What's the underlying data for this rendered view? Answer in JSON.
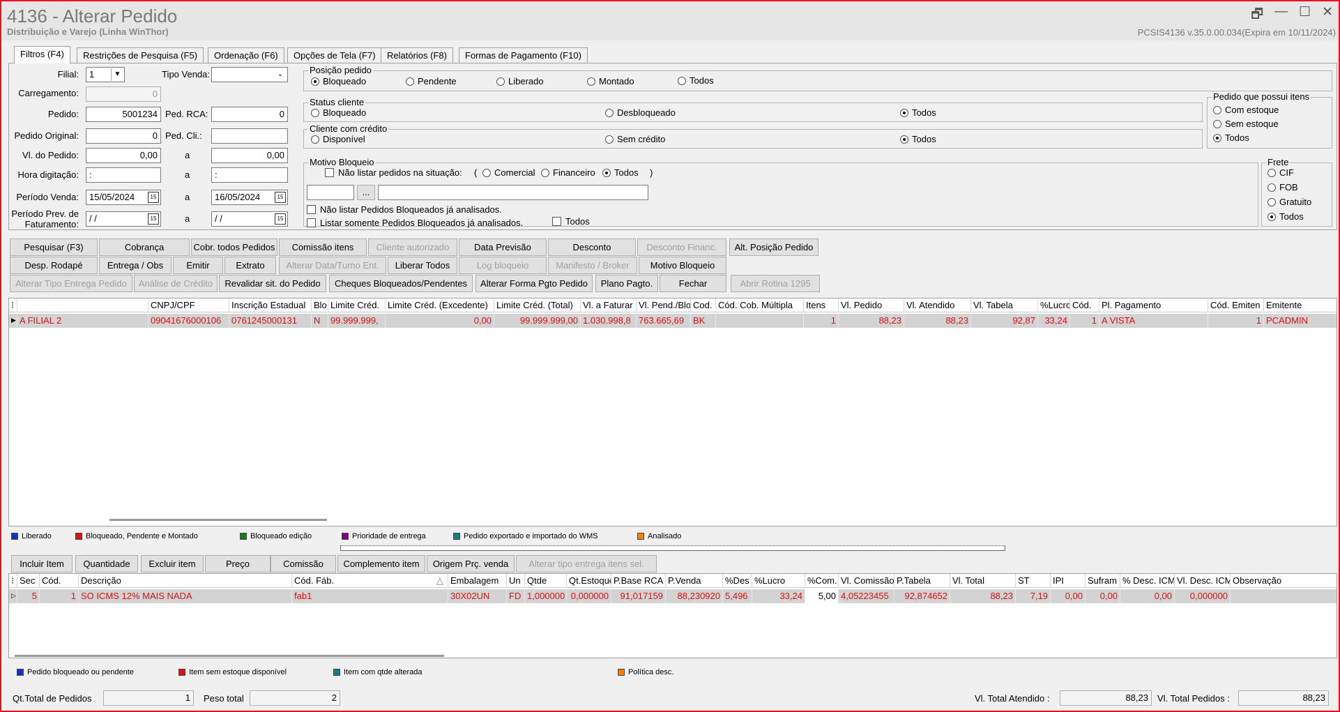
{
  "window": {
    "title": "4136 - Alterar Pedido",
    "subtitle": "Distribuição e Varejo (Linha WinThor)",
    "version": "PCSIS4136  v.35.0.00.034(Expira em 10/11/2024)",
    "controls": [
      "🗗",
      "—",
      "☐",
      "✕"
    ]
  },
  "tabs": [
    "Filtros (F4)",
    "Restrições de Pesquisa (F5)",
    "Ordenação (F6)",
    "Opções de Tela (F7)",
    "Relatórios (F8)",
    "Formas de Pagamento (F10)"
  ],
  "filters": {
    "filial_label": "Filial:",
    "filial_value": "1",
    "tipo_venda_label": "Tipo Venda:",
    "tipo_venda_value": "",
    "carregamento_label": "Carregamento:",
    "carregamento_value": "0",
    "pedido_label": "Pedido:",
    "pedido_value": "5001234",
    "ped_rca_label": "Ped. RCA:",
    "ped_rca_value": "0",
    "pedido_original_label": "Pedido Original:",
    "pedido_original_value": "0",
    "ped_cli_label": "Ped. Cli.:",
    "ped_cli_value": "",
    "vl_pedido_label": "Vl. do Pedido:",
    "vl_pedido_from": "0,00",
    "vl_pedido_to": "0,00",
    "a": "a",
    "hora_label": "Hora digitação:",
    "hora_from": ":",
    "hora_to": ":",
    "periodo_venda_label": "Período Venda:",
    "periodo_venda_from": "15/05/2024",
    "periodo_venda_to": "16/05/2024",
    "periodo_prev_label1": "Período Prev. de",
    "periodo_prev_label2": "Faturamento:",
    "periodo_prev_from": "/ /",
    "periodo_prev_to": "/ /",
    "cal_icon": "15"
  },
  "posicao": {
    "title": "Posição pedido",
    "options": [
      "Bloqueado",
      "Pendente",
      "Liberado",
      "Montado",
      "Todos"
    ]
  },
  "status_cliente": {
    "title": "Status cliente",
    "options": [
      "Bloqueado",
      "Desbloqueado",
      "Todos"
    ]
  },
  "cliente_credito": {
    "title": "Cliente com crédito",
    "options": [
      "Disponível",
      "Sem crédito",
      "Todos"
    ]
  },
  "pedido_itens": {
    "title": "Pedido que possui itens",
    "options": [
      "Com estoque",
      "Sem estoque",
      "Todos"
    ]
  },
  "motivo": {
    "title": "Motivo Bloqueio",
    "nao_listar": "Não listar pedidos na situação:",
    "paren_open": "(",
    "paren_close": ")",
    "opts": [
      "Comercial",
      "Financeiro",
      "Todos"
    ],
    "ellipsis": "...",
    "chk1": "Não listar Pedidos Bloqueados já analisados.",
    "chk2": "Listar somente Pedidos Bloqueados já analisados.",
    "chk_todos": "Todos"
  },
  "frete": {
    "title": "Frete",
    "options": [
      "CIF",
      "FOB",
      "Gratuito",
      "Todos"
    ]
  },
  "buttons": {
    "row1": [
      "Pesquisar (F3)",
      "Cobrança",
      "Cobr. todos Pedidos",
      "Comissão itens",
      "Cliente autorizado",
      "Data Previsão",
      "Desconto",
      "Desconto Financ.",
      "Alt. Posição Pedido"
    ],
    "row2": [
      "Desp. Rodapé",
      "Entrega / Obs",
      "Emitir",
      "Extrato",
      "Alterar Data/Turno Ent.",
      "Liberar Todos",
      "Log bloqueio",
      "Manifesto / Broker",
      "Motivo Bloqueio"
    ],
    "row3": [
      "Alterar Tipo Entrega Pedido",
      "Análise de Crédito",
      "Revalidar sit. do Pedido",
      "Cheques Bloqueados/Pendentes",
      "Alterar Forma Pgto Pedido",
      "Plano Pagto.",
      "Fechar",
      "Abrir Rotina 1295"
    ]
  },
  "orders_grid": {
    "headers": [
      "",
      "",
      "CNPJ/CPF",
      "Inscrição Estadual",
      "Blo",
      "Limite Créd.",
      "Limite Créd. (Excedente)",
      "Limite Créd. (Total)",
      "Vl. a Faturar",
      "Vl. Pend./Blo",
      "Cod.",
      "Cód. Cob. Múltipla",
      "Itens",
      "Vl. Pedido",
      "Vl. Atendido",
      "Vl. Tabela",
      "%Lucro",
      "Cód.",
      "Pl. Pagamento",
      "Cód. Emiten",
      "Emitente"
    ],
    "row": [
      "▶",
      "A FILIAL 2",
      "09041676000106",
      "0761245000131",
      "N",
      "99.999.999,",
      "0,00",
      "99.999.999,00",
      "1.030.998,8",
      "763.665,69",
      "BK",
      "",
      "1",
      "88,23",
      "88,23",
      "92,87",
      "33,24",
      "1",
      "A VISTA",
      "1",
      "PCADMIN"
    ]
  },
  "legend1": [
    {
      "label": "Liberado",
      "color": "#1030d0"
    },
    {
      "label": "Bloqueado, Pendente e Montado",
      "color": "#e01010"
    },
    {
      "label": "Bloqueado edição",
      "color": "#108010"
    },
    {
      "label": "Prioridade de entrega",
      "color": "#800080"
    },
    {
      "label": "Pedido exportado e importado do WMS",
      "color": "#108080"
    },
    {
      "label": "Analisado",
      "color": "#ff8000"
    }
  ],
  "item_buttons": [
    "Incluir Item",
    "Quantidade",
    "Excluir item",
    "Preço",
    "Comissão",
    "Complemento item",
    "Origem Prç. venda",
    "Alterar tipo entrega itens sel."
  ],
  "items_grid": {
    "headers": [
      "",
      "Sec",
      "Cód.",
      "Descrição",
      "Cód. Fáb.",
      "Embalagem",
      "Un",
      "Qtde",
      "Qt.Estoque",
      "P.Base RCA",
      "P.Venda",
      "%Des",
      "%Lucro",
      "%Com.",
      "Vl. Comissão",
      "P.Tabela",
      "Vl. Total",
      "ST",
      "IPI",
      "Sufram",
      "% Desc. ICM",
      "Vl. Desc. ICM",
      "Observação"
    ],
    "sort_icon": "△",
    "row": [
      "▷",
      "5",
      "1",
      "SO ICMS 12% MAIS NADA",
      "fab1",
      "30X02UN",
      "FD",
      "1,000000",
      "0,000000",
      "91,017159",
      "88,230920",
      "5,496",
      "33,24",
      "5,00",
      "4,05223455",
      "92,874652",
      "88,23",
      "7,19",
      "0,00",
      "0,00",
      "0,00",
      "0,000000",
      ""
    ]
  },
  "legend2": [
    {
      "label": "Pedido bloqueado ou pendente",
      "color": "#1030d0"
    },
    {
      "label": "Item sem estoque disponível",
      "color": "#e01010"
    },
    {
      "label": "Item com qtde alterada",
      "color": "#108080"
    },
    {
      "label": "Política desc.",
      "color": "#ff8000"
    }
  ],
  "footer": {
    "qt_total_label": "Qt.Total de Pedidos",
    "qt_total_value": "1",
    "peso_label": "Peso total",
    "peso_value": "2",
    "vl_atendido_label": "Vl. Total Atendido :",
    "vl_atendido_value": "88,23",
    "vl_pedidos_label": "Vl. Total Pedidos :",
    "vl_pedidos_value": "88,23"
  }
}
